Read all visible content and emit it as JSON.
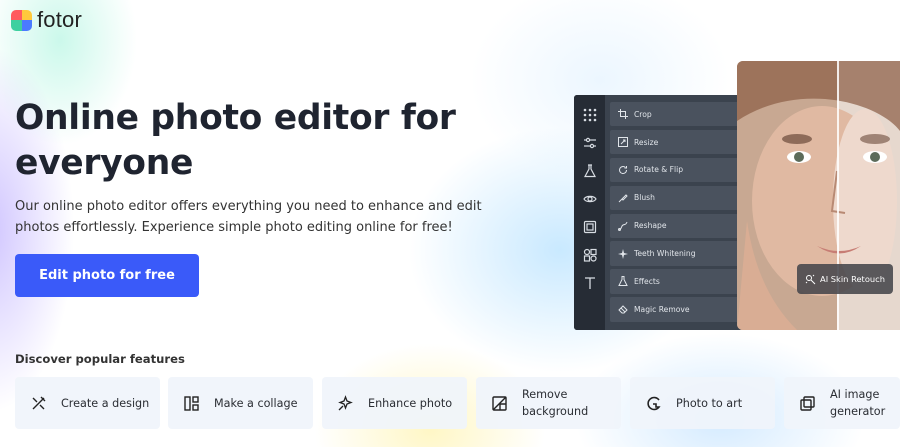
{
  "logo": {
    "text": "fotor",
    "icon": "fotor-logo-icon"
  },
  "hero": {
    "title": "Online photo editor for everyone",
    "description": "Our online photo editor offers everything you need to enhance and edit photos effortlessly. Experience simple photo editing online for free!",
    "cta_label": "Edit photo for free",
    "cta_color": "#3a5af9"
  },
  "editor": {
    "rail_icons": [
      "grid-icon",
      "sliders-icon",
      "flask-icon",
      "eye-icon",
      "frame-icon",
      "shapes-icon",
      "text-icon"
    ],
    "tools": [
      {
        "label": "Crop",
        "icon": "crop-icon"
      },
      {
        "label": "Resize",
        "icon": "resize-icon"
      },
      {
        "label": "Rotate & Flip",
        "icon": "rotate-icon"
      },
      {
        "label": "Blush",
        "icon": "blush-icon"
      },
      {
        "label": "Reshape",
        "icon": "reshape-icon"
      },
      {
        "label": "Teeth Whitening",
        "icon": "sparkle-icon"
      },
      {
        "label": "Effects",
        "icon": "flask-icon"
      },
      {
        "label": "Magic Remove",
        "icon": "eraser-icon"
      }
    ],
    "badge": "AI Skin Retouch"
  },
  "features": {
    "title": "Discover popular features",
    "items": [
      {
        "label": "Create a design",
        "icon": "design-tools-icon"
      },
      {
        "label": "Make a collage",
        "icon": "collage-icon"
      },
      {
        "label": "Enhance photo",
        "icon": "enhance-icon"
      },
      {
        "label": "Remove background",
        "icon": "remove-bg-icon"
      },
      {
        "label": "Photo to art",
        "icon": "art-icon"
      },
      {
        "label": "AI image generator",
        "icon": "ai-generator-icon"
      }
    ]
  }
}
